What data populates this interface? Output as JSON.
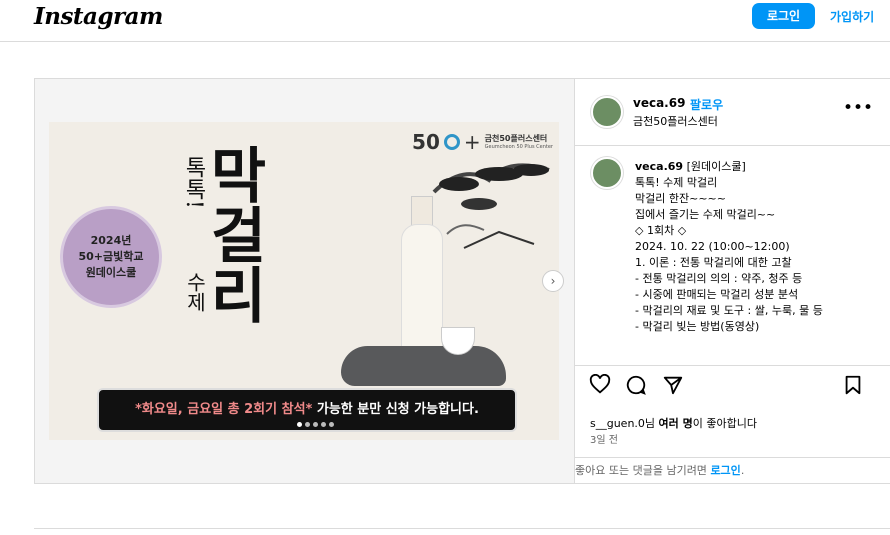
{
  "header": {
    "logo": "Instagram",
    "login_label": "로그인",
    "signup_label": "가입하기"
  },
  "post": {
    "username": "veca.69",
    "separator": "•",
    "follow_label": "팔로우",
    "location": "금천50플러스센터",
    "poster": {
      "center_name": "금천50플러스센터",
      "center_sub": "Geumcheon 50 Plus Center",
      "logo_num": "50",
      "badge_lines": [
        "2024년",
        "50+금빛학교",
        "원데이스쿨"
      ],
      "title_small": "톡톡!",
      "title_main": "막걸리",
      "title_side": "수제",
      "banner_prefix": "*화요일, 금요일 총 2회기 참석*",
      "banner_suffix": " 가능한 분만 신청 가능합니다."
    },
    "carousel": {
      "total": 5,
      "active": 0
    },
    "caption": {
      "user": "veca.69",
      "lines": [
        "[원데이스쿨]",
        "톡톡! 수제 막걸리",
        "",
        "막걸리 한잔~~~~",
        "집에서 즐기는 수제 막걸리~~",
        "",
        "◇ 1회차 ◇",
        "2024. 10. 22 (10:00~12:00)",
        "1. 이론 : 전통 막걸리에 대한 고찰",
        "- 전통 막걸리의 의의 : 약주, 청주 등",
        "- 시중에 판매되는 막걸리 성분 분석",
        "- 막걸리의 재료 및 도구 : 쌀, 누룩, 물 등",
        "- 막걸리 빚는 방법(동영상)"
      ]
    },
    "likes": {
      "user": "s__guen.0",
      "text_mid": "님 ",
      "others": "여러 명",
      "text_end": "이 좋아합니다"
    },
    "date": "3일 전",
    "login_prompt": "좋아요 또는 댓글을 남기려면 ",
    "login_link": "로그인",
    "login_end": "."
  },
  "icons": {
    "like": "heart-icon",
    "comment": "comment-icon",
    "share": "share-icon",
    "save": "bookmark-icon",
    "more": "more-options-icon",
    "next": "chevron-right-icon"
  }
}
